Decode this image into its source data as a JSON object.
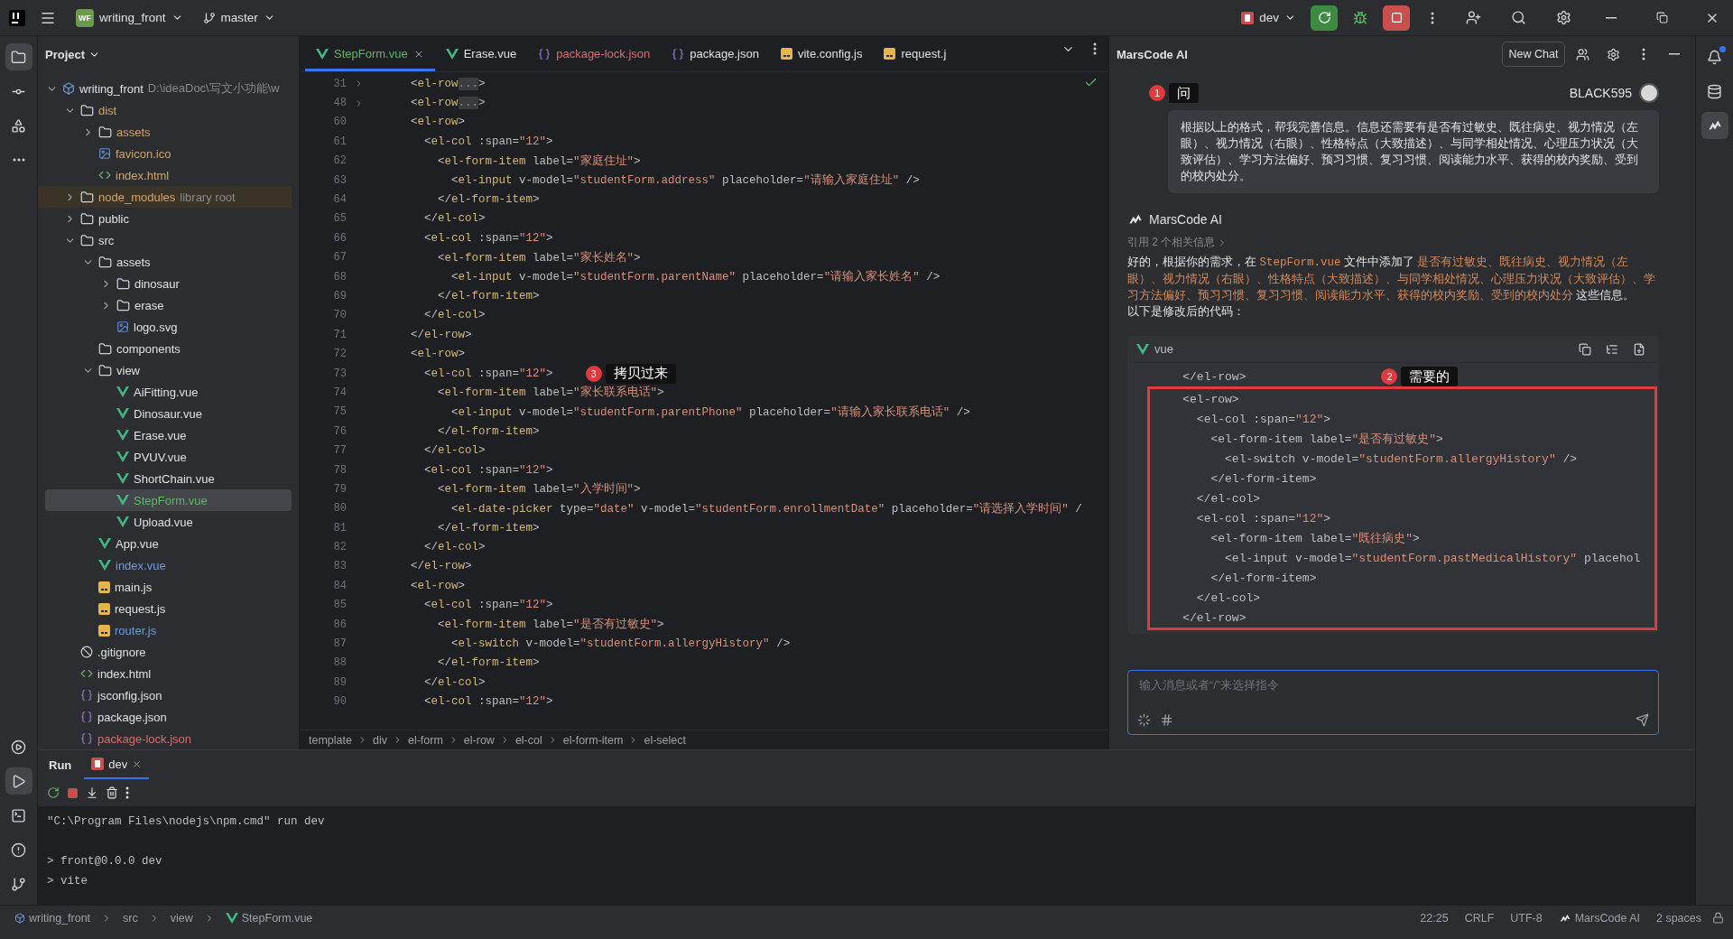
{
  "title_bar": {
    "project_badge": "WF",
    "project": "writing_front",
    "branch": "master",
    "run_config": "dev"
  },
  "tool_strip": {
    "top": [
      {
        "kind": "project",
        "selected": true
      },
      {
        "kind": "commit",
        "selected": false
      },
      {
        "kind": "structure",
        "selected": false
      },
      {
        "kind": "more",
        "selected": false
      }
    ],
    "bottom": [
      {
        "kind": "services",
        "selected": false
      },
      {
        "kind": "run",
        "selected": true
      },
      {
        "kind": "terminal",
        "selected": false
      },
      {
        "kind": "problems",
        "selected": false
      },
      {
        "kind": "git",
        "selected": false
      }
    ]
  },
  "project_panel": {
    "title": "Project",
    "tree": [
      {
        "name": "writing_front",
        "kind": "module",
        "note": "D:\\ideaDoc\\写文小功能\\w",
        "expanded": true,
        "selected": false,
        "color": "#dfe1e5",
        "children": [
          {
            "name": "dist",
            "kind": "folder",
            "expanded": true,
            "selected": false,
            "color": "#d0a46c",
            "children": [
              {
                "name": "assets",
                "kind": "folder",
                "expanded": false,
                "selected": false,
                "color": "#d0a46c"
              },
              {
                "name": "favicon.ico",
                "kind": "image",
                "selected": false,
                "color": "#d0a46c"
              },
              {
                "name": "index.html",
                "kind": "html",
                "selected": false,
                "color": "#d0a46c"
              }
            ]
          },
          {
            "name": "node_modules",
            "kind": "folder",
            "note": "library root",
            "library": true,
            "expanded": false,
            "selected": false,
            "color": "#d0a46c"
          },
          {
            "name": "public",
            "kind": "folder",
            "expanded": false,
            "selected": false,
            "color": "#dfe1e5"
          },
          {
            "name": "src",
            "kind": "folder",
            "expanded": true,
            "selected": false,
            "color": "#dfe1e5",
            "children": [
              {
                "name": "assets",
                "kind": "folder",
                "expanded": true,
                "selected": false,
                "color": "#dfe1e5",
                "children": [
                  {
                    "name": "dinosaur",
                    "kind": "folder",
                    "expanded": false,
                    "selected": false,
                    "color": "#dfe1e5"
                  },
                  {
                    "name": "erase",
                    "kind": "folder",
                    "expanded": false,
                    "selected": false,
                    "color": "#dfe1e5"
                  },
                  {
                    "name": "logo.svg",
                    "kind": "image",
                    "selected": false,
                    "color": "#dfe1e5"
                  }
                ]
              },
              {
                "name": "components",
                "kind": "empty-folder",
                "selected": false,
                "color": "#dfe1e5"
              },
              {
                "name": "view",
                "kind": "folder",
                "expanded": true,
                "selected": false,
                "color": "#dfe1e5",
                "children": [
                  {
                    "name": "AiFitting.vue",
                    "kind": "vue",
                    "selected": false,
                    "color": "#dfe1e5"
                  },
                  {
                    "name": "Dinosaur.vue",
                    "kind": "vue",
                    "selected": false,
                    "color": "#dfe1e5"
                  },
                  {
                    "name": "Erase.vue",
                    "kind": "vue",
                    "selected": false,
                    "color": "#dfe1e5"
                  },
                  {
                    "name": "PVUV.vue",
                    "kind": "vue",
                    "selected": false,
                    "color": "#dfe1e5"
                  },
                  {
                    "name": "ShortChain.vue",
                    "kind": "vue",
                    "selected": false,
                    "color": "#dfe1e5"
                  },
                  {
                    "name": "StepForm.vue",
                    "kind": "vue",
                    "selected": true,
                    "color": "#5fb865"
                  },
                  {
                    "name": "Upload.vue",
                    "kind": "vue",
                    "selected": false,
                    "color": "#dfe1e5"
                  }
                ]
              },
              {
                "name": "App.vue",
                "kind": "vue",
                "selected": false,
                "color": "#dfe1e5"
              },
              {
                "name": "index.vue",
                "kind": "vue",
                "selected": false,
                "color": "#6f9bd8"
              },
              {
                "name": "main.js",
                "kind": "js",
                "selected": false,
                "color": "#dfe1e5"
              },
              {
                "name": "request.js",
                "kind": "js",
                "selected": false,
                "color": "#dfe1e5"
              },
              {
                "name": "router.js",
                "kind": "js",
                "selected": false,
                "color": "#6f9bd8"
              }
            ]
          },
          {
            "name": ".gitignore",
            "kind": "ignore",
            "selected": false,
            "color": "#dfe1e5"
          },
          {
            "name": "index.html",
            "kind": "html",
            "selected": false,
            "color": "#dfe1e5"
          },
          {
            "name": "jsconfig.json",
            "kind": "json",
            "selected": false,
            "color": "#dfe1e5"
          },
          {
            "name": "package.json",
            "kind": "json",
            "selected": false,
            "color": "#dfe1e5"
          },
          {
            "name": "package-lock.json",
            "kind": "json",
            "selected": false,
            "color": "#d96f6f"
          }
        ]
      }
    ]
  },
  "editor": {
    "tabs": [
      {
        "label": "StepForm.vue",
        "kind": "vue",
        "selected": true,
        "color": "#5fb865"
      },
      {
        "label": "Erase.vue",
        "kind": "vue",
        "selected": false,
        "color": "#dfe1e5"
      },
      {
        "label": "package-lock.json",
        "kind": "json",
        "selected": false,
        "color": "#d96f6f"
      },
      {
        "label": "package.json",
        "kind": "json",
        "selected": false,
        "color": "#dfe1e5"
      },
      {
        "label": "vite.config.js",
        "kind": "js",
        "selected": false,
        "color": "#dfe1e5"
      },
      {
        "label": "request.j",
        "kind": "js",
        "selected": false,
        "color": "#dfe1e5"
      }
    ],
    "lines": [
      {
        "number": "31",
        "text": "      <el-row...>",
        "folded": true
      },
      {
        "number": "48",
        "text": "      <el-row...>",
        "folded": true
      },
      {
        "number": "60",
        "text": "      <el-row>",
        "folded": false
      },
      {
        "number": "61",
        "text": "        <el-col :span=\"12\">",
        "folded": false
      },
      {
        "number": "62",
        "text": "          <el-form-item label=\"家庭住址\">",
        "folded": false
      },
      {
        "number": "63",
        "text": "            <el-input v-model=\"studentForm.address\" placeholder=\"请输入家庭住址\" />",
        "folded": false
      },
      {
        "number": "64",
        "text": "          </el-form-item>",
        "folded": false
      },
      {
        "number": "65",
        "text": "        </el-col>",
        "folded": false
      },
      {
        "number": "66",
        "text": "        <el-col :span=\"12\">",
        "folded": false
      },
      {
        "number": "67",
        "text": "          <el-form-item label=\"家长姓名\">",
        "folded": false
      },
      {
        "number": "68",
        "text": "            <el-input v-model=\"studentForm.parentName\" placeholder=\"请输入家长姓名\" />",
        "folded": false
      },
      {
        "number": "69",
        "text": "          </el-form-item>",
        "folded": false
      },
      {
        "number": "70",
        "text": "        </el-col>",
        "folded": false
      },
      {
        "number": "71",
        "text": "      </el-row>",
        "folded": false
      },
      {
        "number": "72",
        "text": "      <el-row>",
        "folded": false
      },
      {
        "number": "73",
        "text": "        <el-col :span=\"12\">",
        "folded": false,
        "annotation": {
          "number": "3",
          "label": "拷贝过来"
        }
      },
      {
        "number": "74",
        "text": "          <el-form-item label=\"家长联系电话\">",
        "folded": false
      },
      {
        "number": "75",
        "text": "            <el-input v-model=\"studentForm.parentPhone\" placeholder=\"请输入家长联系电话\" />",
        "folded": false
      },
      {
        "number": "76",
        "text": "          </el-form-item>",
        "folded": false
      },
      {
        "number": "77",
        "text": "        </el-col>",
        "folded": false
      },
      {
        "number": "78",
        "text": "        <el-col :span=\"12\">",
        "folded": false
      },
      {
        "number": "79",
        "text": "          <el-form-item label=\"入学时间\">",
        "folded": false
      },
      {
        "number": "80",
        "text": "            <el-date-picker type=\"date\" v-model=\"studentForm.enrollmentDate\" placeholder=\"请选择入学时间\" /",
        "folded": false
      },
      {
        "number": "81",
        "text": "          </el-form-item>",
        "folded": false
      },
      {
        "number": "82",
        "text": "        </el-col>",
        "folded": false
      },
      {
        "number": "83",
        "text": "      </el-row>",
        "folded": false
      },
      {
        "number": "84",
        "text": "      <el-row>",
        "folded": false
      },
      {
        "number": "85",
        "text": "        <el-col :span=\"12\">",
        "folded": false
      },
      {
        "number": "86",
        "text": "          <el-form-item label=\"是否有过敏史\">",
        "folded": false
      },
      {
        "number": "87",
        "text": "            <el-switch v-model=\"studentForm.allergyHistory\" />",
        "folded": false
      },
      {
        "number": "88",
        "text": "          </el-form-item>",
        "folded": false
      },
      {
        "number": "89",
        "text": "        </el-col>",
        "folded": false
      },
      {
        "number": "90",
        "text": "        <el-col :span=\"12\">",
        "folded": false
      }
    ],
    "breadcrumb": [
      "template",
      "div",
      "el-form",
      "el-row",
      "el-col",
      "el-form-item",
      "el-select"
    ]
  },
  "ai_panel": {
    "title": "MarsCode AI",
    "new_chat": "New Chat",
    "user": {
      "name": "BLACK595",
      "annotation": {
        "number": "1",
        "label": "问"
      },
      "message": "根据以上的格式，帮我完善信息。信息还需要有是否有过敏史、既往病史、视力情况（左眼）、视力情况（右眼）、性格特点（大致描述）、与同学相处情况、心理压力状况（大致评估）、学习方法偏好、预习习惯、复习习惯、阅读能力水平、获得的校内奖励、受到的校内处分。"
    },
    "reply": {
      "author": "MarsCode AI",
      "references": "引用 2 个相关信息",
      "segments": [
        {
          "kind": "plain",
          "text": "好的，根据你的需求，在 "
        },
        {
          "kind": "code",
          "text": "StepForm.vue"
        },
        {
          "kind": "plain",
          "text": " 文件中添加了 "
        },
        {
          "kind": "highlight",
          "text": "是否有过敏史、既往病史、视力情况（左眼）、视力情况（右眼）、性格特点（大致描述）、与同学相处情况、心理压力状况（大致评估）、学习方法偏好、预习习惯、复习习惯、阅读能力水平、获得的校内奖励、受到的校内处分"
        },
        {
          "kind": "plain",
          "text": " 这些信息。"
        }
      ],
      "outro": "以下是修改后的代码：",
      "code": {
        "language": "vue",
        "lines": [
          {
            "text": "    </el-row>",
            "highlighted": false,
            "annotation": {
              "number": "2",
              "label": "需要的"
            }
          },
          {
            "text": "    <el-row>",
            "highlighted": true
          },
          {
            "text": "      <el-col :span=\"12\">",
            "highlighted": true
          },
          {
            "text": "        <el-form-item label=\"是否有过敏史\">",
            "highlighted": true
          },
          {
            "text": "          <el-switch v-model=\"studentForm.allergyHistory\" />",
            "highlighted": true
          },
          {
            "text": "        </el-form-item>",
            "highlighted": true
          },
          {
            "text": "      </el-col>",
            "highlighted": true
          },
          {
            "text": "      <el-col :span=\"12\">",
            "highlighted": true
          },
          {
            "text": "        <el-form-item label=\"既往病史\">",
            "highlighted": true
          },
          {
            "text": "          <el-input v-model=\"studentForm.pastMedicalHistory\" placehol",
            "highlighted": true
          },
          {
            "text": "        </el-form-item>",
            "highlighted": true
          },
          {
            "text": "      </el-col>",
            "highlighted": true
          },
          {
            "text": "    </el-row>",
            "highlighted": true
          }
        ]
      }
    },
    "input": {
      "placeholder": "输入消息或者“/”来选择指令"
    }
  },
  "right_strip": [
    {
      "kind": "notifications",
      "selected": false,
      "unread": true
    },
    {
      "kind": "database",
      "selected": false,
      "unread": false
    },
    {
      "kind": "marscode",
      "selected": true,
      "unread": false
    }
  ],
  "run_panel": {
    "title": "Run",
    "tabs": [
      {
        "label": "dev",
        "selected": true
      }
    ],
    "console": [
      [
        "\"C:\\Program Files\\nodejs\\npm.cmd\" run dev"
      ],
      [
        "> front@0.0.0 dev",
        "> vite"
      ]
    ]
  },
  "status_bar": {
    "path": [
      {
        "kind": "module",
        "text": "writing_front"
      },
      {
        "kind": "folder",
        "text": "src"
      },
      {
        "kind": "folder",
        "text": "view"
      },
      {
        "kind": "vue",
        "text": "StepForm.vue"
      }
    ],
    "items": [
      {
        "kind": "text",
        "text": "22:25"
      },
      {
        "kind": "text",
        "text": "CRLF"
      },
      {
        "kind": "text",
        "text": "UTF-8"
      },
      {
        "kind": "marscode",
        "text": "MarsCode AI"
      },
      {
        "kind": "text",
        "text": "2 spaces"
      }
    ]
  }
}
